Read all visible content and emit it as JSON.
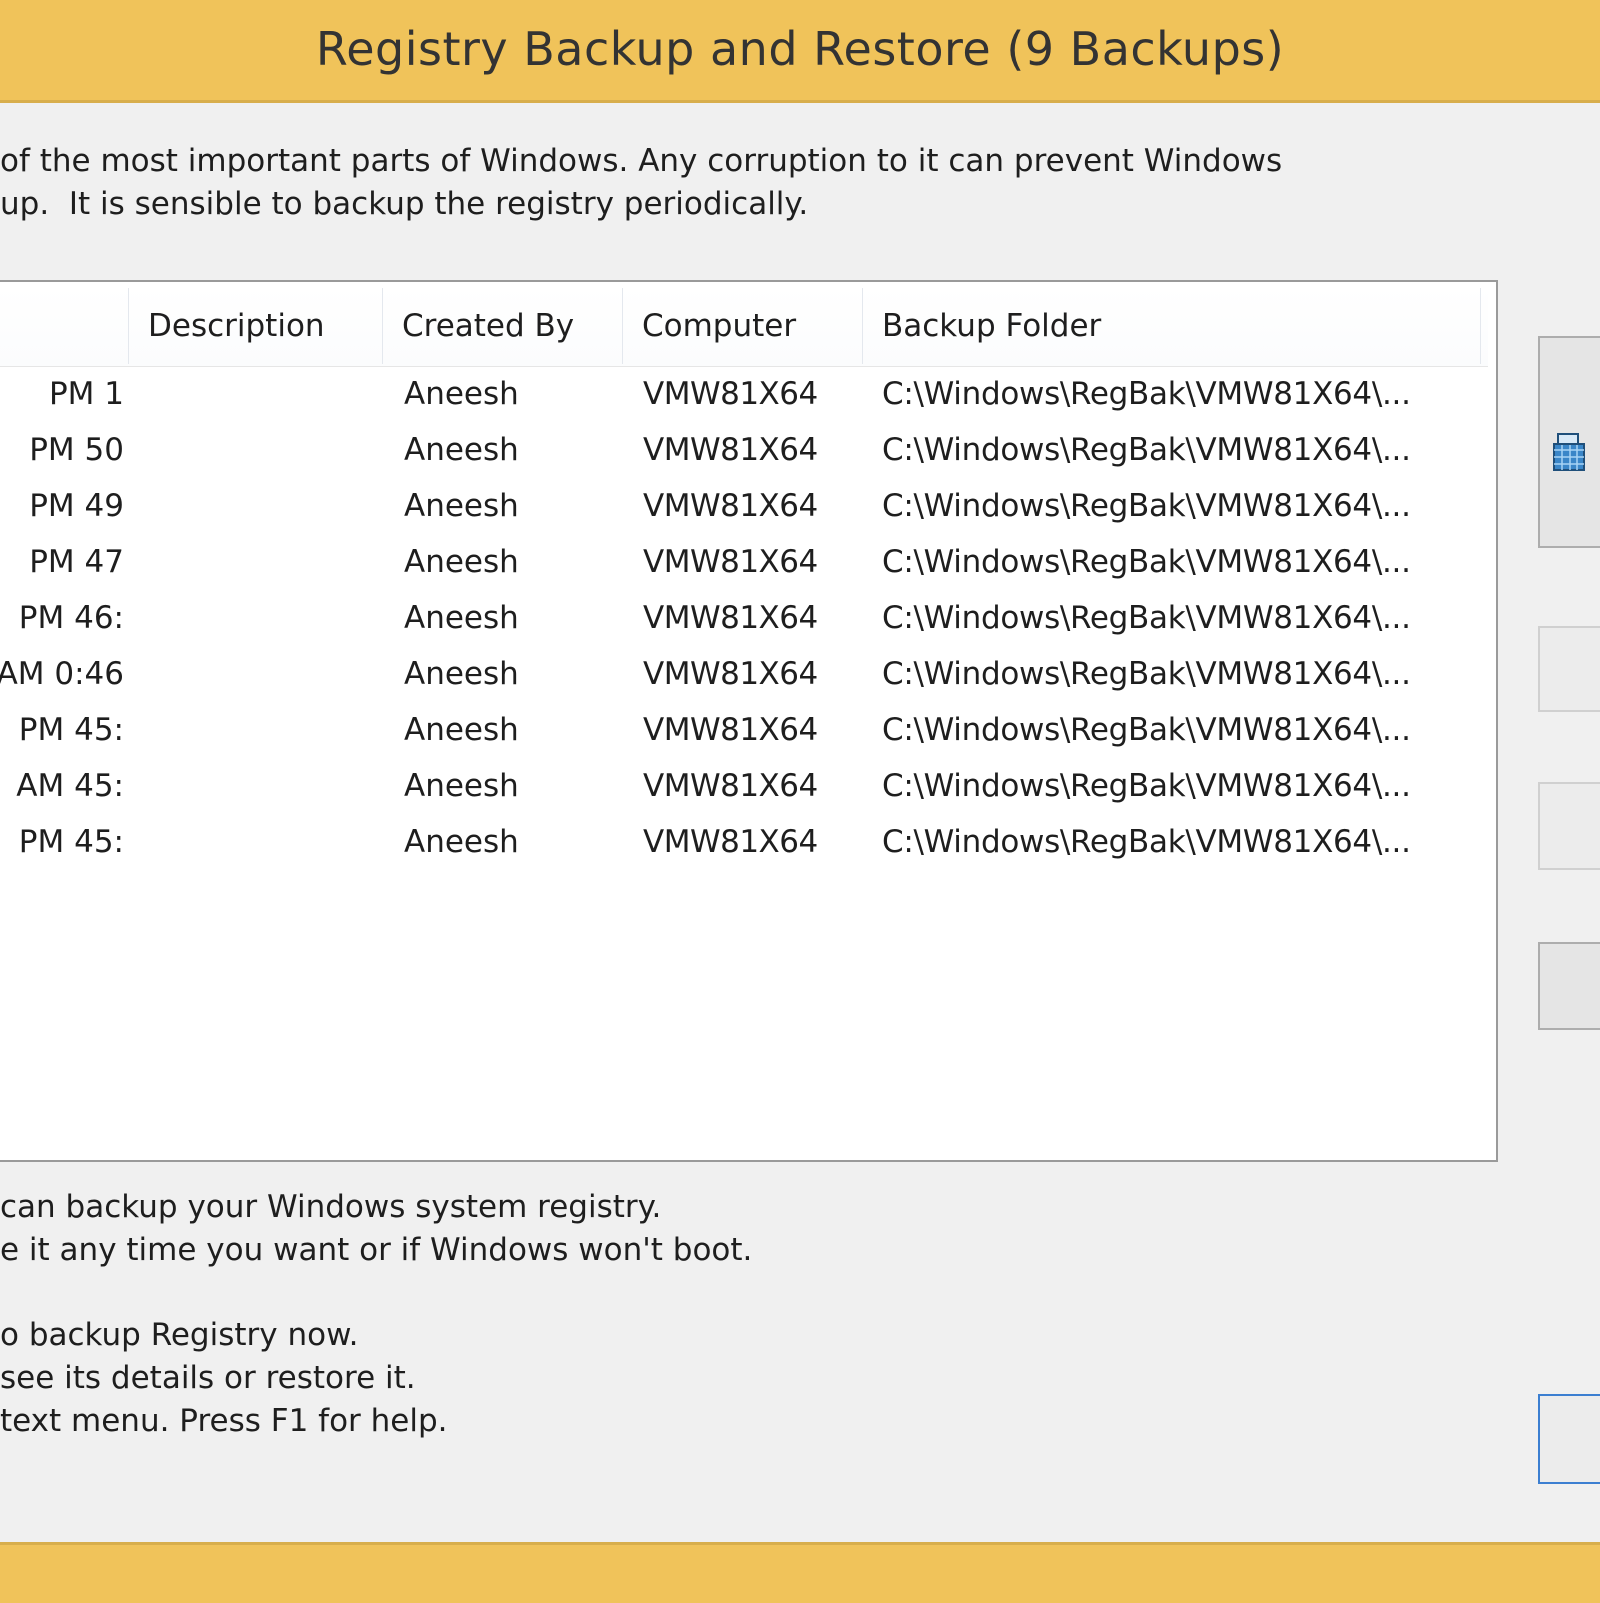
{
  "window": {
    "title": "Registry Backup and Restore  (9 Backups)"
  },
  "intro_text": "of the most important parts of Windows. Any corruption to it can prevent Windows\nup.  It is sensible to backup the registry periodically.",
  "table": {
    "columns": [
      "Description",
      "Created By",
      "Computer",
      "Backup Folder"
    ],
    "rows": [
      {
        "date": "1 PM",
        "description": "",
        "created_by": "Aneesh",
        "computer": "VMW81X64",
        "folder": "C:\\Windows\\RegBak\\VMW81X64\\..."
      },
      {
        "date": "50 PM",
        "description": "",
        "created_by": "Aneesh",
        "computer": "VMW81X64",
        "folder": "C:\\Windows\\RegBak\\VMW81X64\\..."
      },
      {
        "date": "49 PM",
        "description": "",
        "created_by": "Aneesh",
        "computer": "VMW81X64",
        "folder": "C:\\Windows\\RegBak\\VMW81X64\\..."
      },
      {
        "date": "47 PM",
        "description": "",
        "created_by": "Aneesh",
        "computer": "VMW81X64",
        "folder": "C:\\Windows\\RegBak\\VMW81X64\\..."
      },
      {
        "date": ":46 PM",
        "description": "",
        "created_by": "Aneesh",
        "computer": "VMW81X64",
        "folder": "C:\\Windows\\RegBak\\VMW81X64\\..."
      },
      {
        "date": "0:46 AM",
        "description": "",
        "created_by": "Aneesh",
        "computer": "VMW81X64",
        "folder": "C:\\Windows\\RegBak\\VMW81X64\\..."
      },
      {
        "date": ":45 PM",
        "description": "",
        "created_by": "Aneesh",
        "computer": "VMW81X64",
        "folder": "C:\\Windows\\RegBak\\VMW81X64\\..."
      },
      {
        "date": ":45 AM",
        "description": "",
        "created_by": "Aneesh",
        "computer": "VMW81X64",
        "folder": "C:\\Windows\\RegBak\\VMW81X64\\..."
      },
      {
        "date": ":45 PM",
        "description": "",
        "created_by": "Aneesh",
        "computer": "VMW81X64",
        "folder": "C:\\Windows\\RegBak\\VMW81X64\\..."
      }
    ]
  },
  "help_text_1": "can backup your Windows system registry.\ne it any time you want or if Windows won't boot.",
  "help_text_2": "o backup Registry now.\nsee its details or restore it.\ntext menu. Press F1 for help.",
  "colors": {
    "title_bar": "#f0c35a",
    "focus_border": "#3c7fd1"
  },
  "icons": {
    "backup_button_icon": "registry-cube-icon"
  }
}
